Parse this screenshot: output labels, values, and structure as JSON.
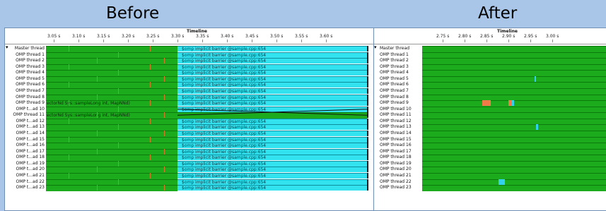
{
  "titles": {
    "before": "Before",
    "after": "After"
  },
  "timeline_label": "Timeline",
  "before": {
    "ticks": [
      "3.05 s",
      "3.10 s",
      "3.15 s",
      "3.20 s",
      "3.25 s",
      "3.30 s",
      "3.35 s",
      "3.40 s",
      "3.45 s",
      "3.50 s",
      "3.55 s",
      "3.60 s"
    ],
    "rows": [
      {
        "label": "Master thread",
        "barrier": "$omp implicit barrier @sample.cpp:654"
      },
      {
        "label": "OMP thread 1",
        "barrier": "$omp implicit barrier @sample.cpp:654"
      },
      {
        "label": "OMP thread 2",
        "barrier": "$omp implicit barrier @sample.cpp:654"
      },
      {
        "label": "OMP thread 3",
        "barrier": "$omp implicit barrier @sample.cpp:654"
      },
      {
        "label": "OMP thread 4",
        "barrier": "$omp implicit barrier @sample.cpp:654"
      },
      {
        "label": "OMP thread 5",
        "barrier": "$omp implicit barrier @sample.cpp:654"
      },
      {
        "label": "OMP thread 6",
        "barrier": "$omp implicit barrier @sample.cpp:654"
      },
      {
        "label": "OMP thread 7",
        "barrier": "$omp implicit barrier @sample.cpp:654"
      },
      {
        "label": "OMP thread 8",
        "barrier": "$omp implicit barrier @sample.cpp:654"
      },
      {
        "label": "OMP thread 9",
        "note": "ectorNd Sys::sampleLong int, MapNNd)",
        "barrier": "$omp implicit barrier @sample.cpp:654"
      },
      {
        "label": "OMP t...ad 10",
        "barrier": "$omp implicit barrier @sample.cpp:654"
      },
      {
        "label": "OMP thread 11",
        "note": "ectorNd Sys::sampleLong int, MapNNd)",
        "barrier": ""
      },
      {
        "label": "OMP t...ad 12",
        "barrier": "$omp implicit barrier @sample.cpp:654"
      },
      {
        "label": "OMP t...ad 13",
        "barrier": "$omp implicit barrier @sample.cpp:654"
      },
      {
        "label": "OMP t...ad 14",
        "barrier": "$omp implicit barrier @sample.cpp:654"
      },
      {
        "label": "OMP t...ad 15",
        "barrier": "$omp implicit barrier @sample.cpp:654"
      },
      {
        "label": "OMP t...ad 16",
        "barrier": "$omp implicit barrier @sample.cpp:654"
      },
      {
        "label": "OMP t...ad 17",
        "barrier": "$omp implicit barrier @sample.cpp:654"
      },
      {
        "label": "OMP t...ad 18",
        "barrier": "$omp implicit barrier @sample.cpp:654"
      },
      {
        "label": "OMP t...ad 19",
        "barrier": "$omp implicit barrier @sample.cpp:654"
      },
      {
        "label": "OMP t...ad 20",
        "barrier": "$omp implicit barrier @sample.cpp:654"
      },
      {
        "label": "OMP t...ad 21",
        "barrier": "$omp implicit barrier @sample.cpp:654"
      },
      {
        "label": "OMP t...ad 22",
        "barrier": "$omp implicit barrier @sample.cpp:654"
      },
      {
        "label": "OMP t...ad 23",
        "barrier": "$omp implicit barrier @sample.cpp:654"
      }
    ]
  },
  "after": {
    "ticks": [
      "2.75 s",
      "2.80 s",
      "2.85 s",
      "2.90 s",
      "2.95 s",
      "3.00 s"
    ],
    "rows": [
      "Master thread",
      "OMP thread 1",
      "OMP thread 2",
      "OMP thread 3",
      "OMP thread 4",
      "OMP thread 5",
      "OMP thread 6",
      "OMP thread 7",
      "OMP thread 8",
      "OMP thread 9",
      "OMP thread 10",
      "OMP thread 11",
      "OMP thread 12",
      "OMP thread 13",
      "OMP thread 14",
      "OMP thread 15",
      "OMP thread 16",
      "OMP thread 17",
      "OMP thread 18",
      "OMP thread 19",
      "OMP thread 20",
      "OMP thread 21",
      "OMP thread 22",
      "OMP thread 23"
    ]
  },
  "colors": {
    "compute": "#1cab1c",
    "barrier": "#33e2ef",
    "hotspot": "#e8584d",
    "background": "#a9c6e8"
  }
}
